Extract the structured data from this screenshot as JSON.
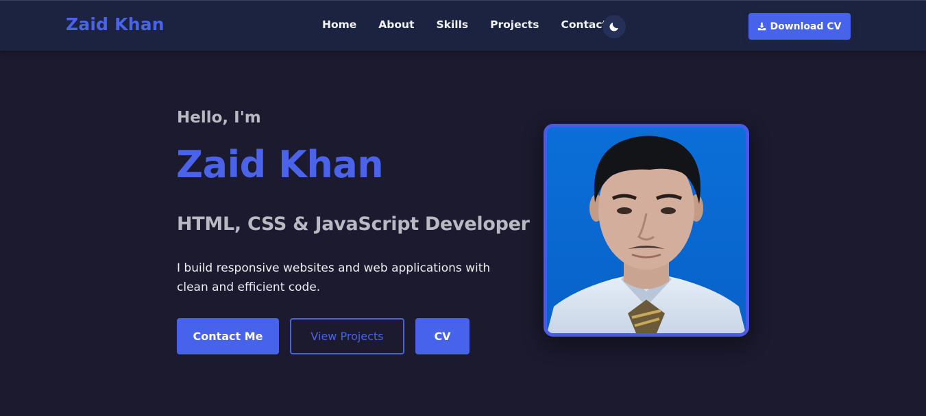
{
  "header": {
    "logo": "Zaid Khan",
    "nav": [
      "Home",
      "About",
      "Skills",
      "Projects",
      "Contact"
    ],
    "theme_toggle_icon": "moon-icon",
    "download_label": "Download CV",
    "download_icon": "download-icon"
  },
  "hero": {
    "greeting": "Hello, I'm",
    "name": "Zaid Khan",
    "role": "HTML, CSS & JavaScript Developer",
    "description": "I build responsive websites and web applications with clean and efficient code.",
    "buttons": {
      "contact": "Contact Me",
      "projects": "View Projects",
      "cv": "CV"
    }
  },
  "colors": {
    "accent": "#4a63e8",
    "background": "#1b1a2e",
    "navbar": "#1c2340",
    "muted_text": "#b9b9c3"
  }
}
